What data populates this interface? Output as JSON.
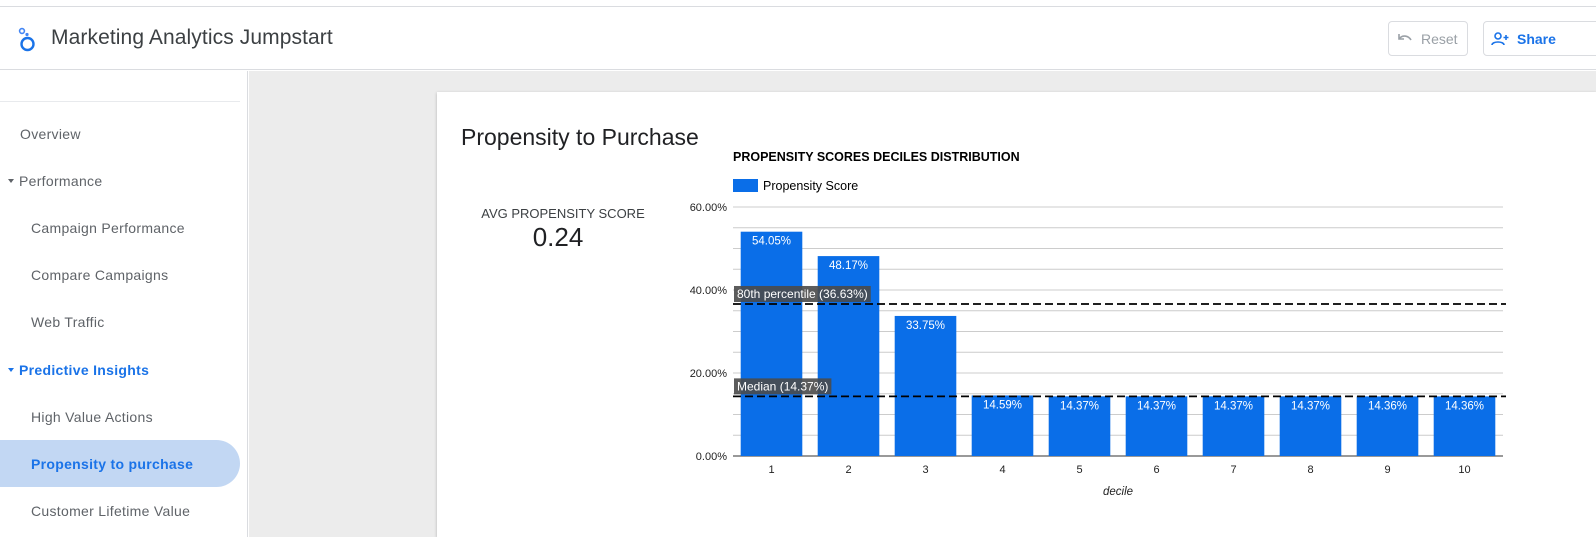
{
  "app": {
    "title": "Marketing Analytics Jumpstart"
  },
  "toolbar": {
    "reset_label": "Reset",
    "share_label": "Share"
  },
  "sidebar": {
    "items": [
      {
        "label": "Overview"
      },
      {
        "label": "Performance"
      },
      {
        "label": "Campaign Performance"
      },
      {
        "label": "Compare Campaigns"
      },
      {
        "label": "Web Traffic"
      },
      {
        "label": "Predictive Insights"
      },
      {
        "label": "High Value Actions"
      },
      {
        "label": "Propensity to purchase"
      },
      {
        "label": "Customer Lifetime Value"
      }
    ]
  },
  "page": {
    "title": "Propensity to Purchase",
    "kpi": {
      "label": "AVG PROPENSITY SCORE",
      "value": "0.24"
    }
  },
  "colors": {
    "accent": "#1a73e8",
    "bar": "#0a6ee8",
    "selected_bg": "#c2d7f3"
  },
  "chart_data": {
    "type": "bar",
    "title": "PROPENSITY SCORES DECILES DISTRIBUTION",
    "legend": "Propensity Score",
    "legend_position": "top-left",
    "xlabel": "decile",
    "ylabel": "",
    "categories": [
      "1",
      "2",
      "3",
      "4",
      "5",
      "6",
      "7",
      "8",
      "9",
      "10"
    ],
    "values": [
      54.05,
      48.17,
      33.75,
      14.59,
      14.37,
      14.37,
      14.37,
      14.37,
      14.36,
      14.36
    ],
    "value_labels": [
      "54.05%",
      "48.17%",
      "33.75%",
      "14.59%",
      "14.37%",
      "14.37%",
      "14.37%",
      "14.37%",
      "14.36%",
      "14.36%"
    ],
    "ylim": [
      0,
      60
    ],
    "yticks": [
      "0.00%",
      "20.00%",
      "40.00%",
      "60.00%"
    ],
    "grid": true,
    "reference_lines": [
      {
        "label": "80th percentile (36.63%)",
        "value": 36.63
      },
      {
        "label": "Median (14.37%)",
        "value": 14.37
      }
    ]
  }
}
